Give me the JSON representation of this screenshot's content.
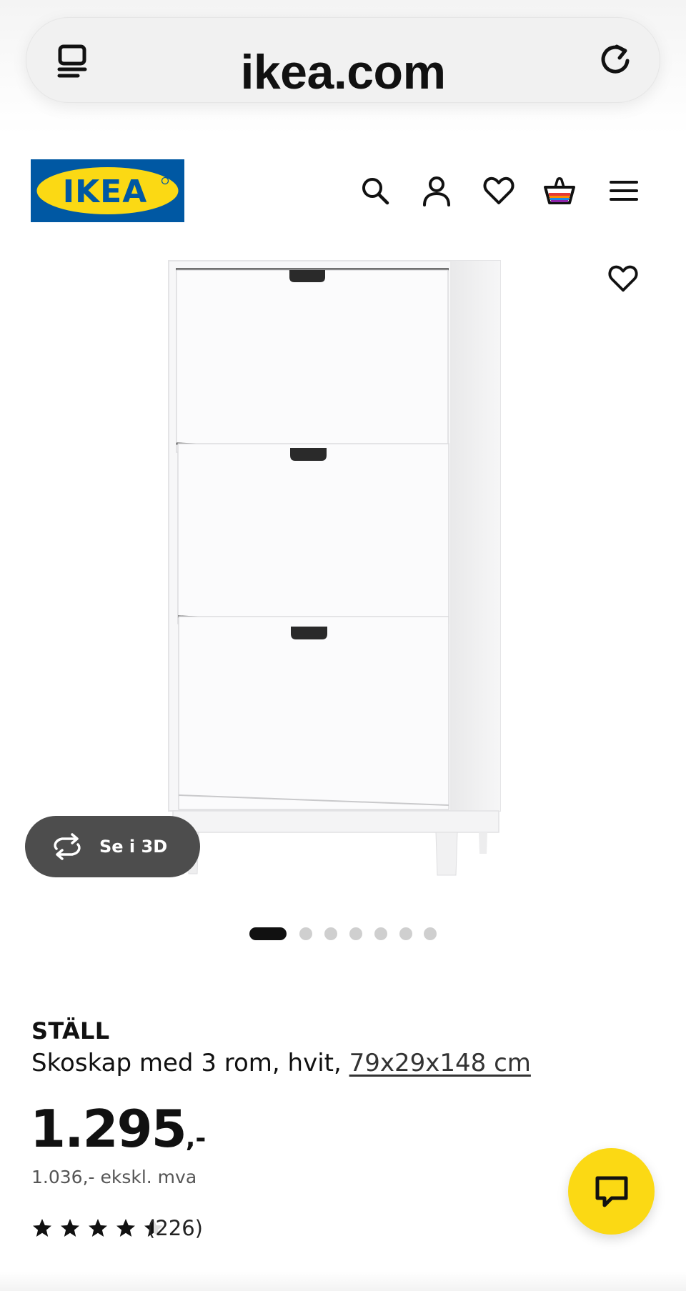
{
  "browser": {
    "url": "ikea.com",
    "tabs_icon": "tabs-icon",
    "reload_icon": "reload-icon"
  },
  "header": {
    "logo_text": "IKEA",
    "icons": [
      "search-icon",
      "profile-icon",
      "heart-icon",
      "shopping-bag-icon",
      "menu-icon"
    ]
  },
  "gallery": {
    "view_3d_label": "Se i 3D",
    "dot_count": 7,
    "active_index": 0
  },
  "product": {
    "brand": "STÄLL",
    "description": "Skoskap med 3 rom, hvit, ",
    "dimensions": "79x29x148 cm",
    "price_main": "1.295",
    "price_suffix": ",-",
    "price_excl_vat": "1.036,- ekskl. mva",
    "rating": 4.5,
    "rating_max": 5,
    "review_count": "(226)"
  },
  "colors": {
    "ikea_blue": "#0058a3",
    "ikea_yellow": "#fbd914",
    "dark_button": "#4d4d4d"
  }
}
